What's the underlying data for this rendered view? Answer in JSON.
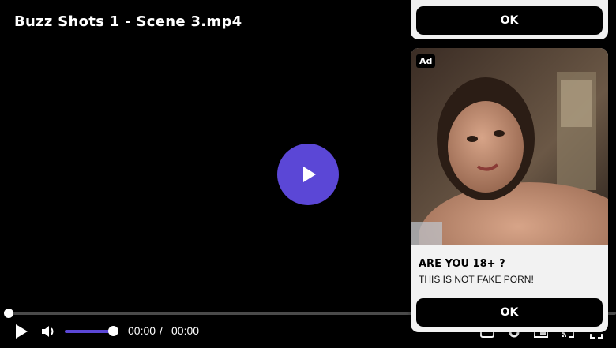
{
  "player": {
    "title": "Buzz Shots 1 - Scene 3.mp4",
    "current_time": "00:00",
    "time_separator": "/",
    "total_time": "00:00",
    "progress_fraction": 0.0,
    "volume_fraction": 1.0,
    "accent_color": "#5b47d6",
    "icons": [
      "play-icon",
      "volume-icon",
      "captions-icon",
      "settings-icon",
      "pip-icon",
      "cast-icon",
      "fullscreen-icon"
    ]
  },
  "ads": {
    "top_card": {
      "ok_label": "OK"
    },
    "main_card": {
      "badge": "Ad",
      "heading": "ARE YOU 18+ ?",
      "text": "THIS IS NOT FAKE PORN!",
      "ok_label": "OK"
    }
  }
}
